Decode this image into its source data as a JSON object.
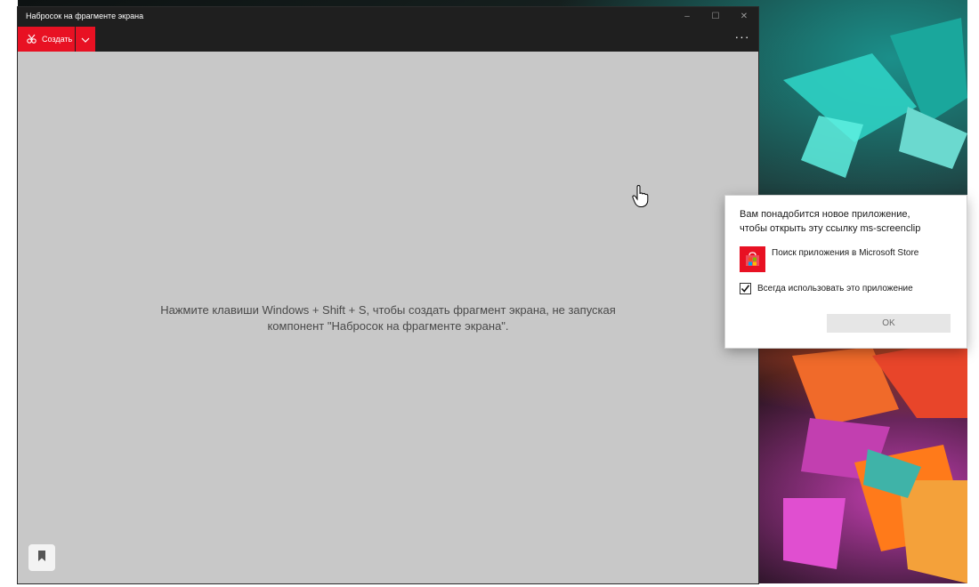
{
  "window": {
    "title": "Набросок на фрагменте экрана",
    "controls": {
      "minimize": "–",
      "maximize": "☐",
      "close": "✕"
    }
  },
  "toolbar": {
    "create_label": "Создать",
    "more_label": "···"
  },
  "canvas": {
    "hint_line1": "Нажмите клавиши Windows + Shift + S, чтобы создать фрагмент экрана, не запуская",
    "hint_line2": "компонент \"Набросок на фрагменте экрана\"."
  },
  "dialog": {
    "message_line1": "Вам понадобится новое приложение,",
    "message_line2": "чтобы открыть эту ссылку ms-screenclip",
    "store_option": "Поиск приложения в Microsoft Store",
    "always_use_label": "Всегда использовать это приложение",
    "always_use_checked": true,
    "ok_label": "OK"
  },
  "colors": {
    "accent": "#e81123",
    "titlebar": "#1f1f1f",
    "canvas": "#c8c8c8"
  },
  "icons": {
    "create": "snip-icon",
    "dropdown": "chevron-down-icon",
    "bookmark": "bookmark-icon",
    "store": "microsoft-store-icon",
    "cursor": "hand-pointer-icon"
  }
}
